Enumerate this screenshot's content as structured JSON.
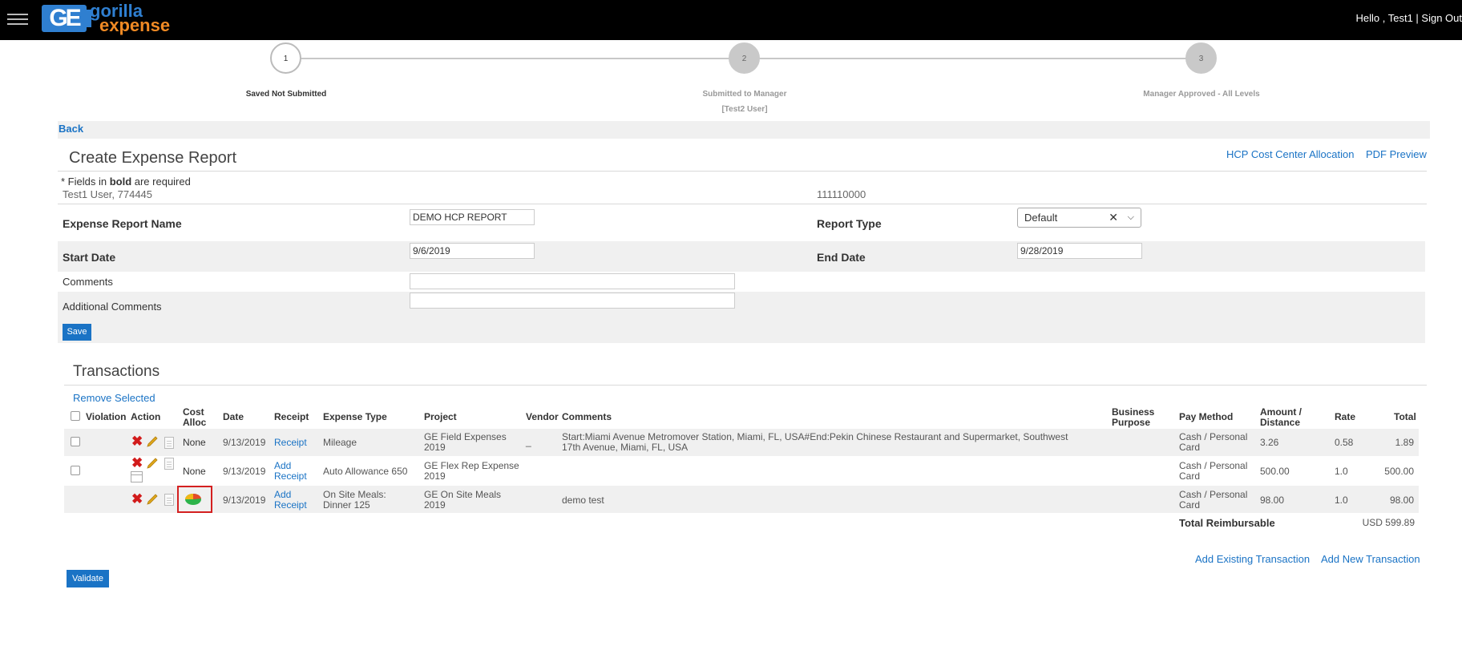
{
  "header": {
    "logo_text_1": "gorilla",
    "logo_text_2": "expense",
    "logo_mark": "GE",
    "greeting": "Hello , Test1 | Sign Out"
  },
  "progress": {
    "steps": [
      {
        "number": "1",
        "label": "Saved Not Submitted",
        "sub": ""
      },
      {
        "number": "2",
        "label": "Submitted to Manager",
        "sub": "[Test2 User]"
      },
      {
        "number": "3",
        "label": "Manager Approved - All Levels",
        "sub": ""
      }
    ]
  },
  "nav": {
    "back": "Back"
  },
  "report": {
    "title": "Create Expense Report",
    "links": {
      "hcp": "HCP Cost Center Allocation",
      "pdf": "PDF Preview"
    },
    "note_prefix": "* Fields in ",
    "note_bold": "bold",
    "note_suffix": " are required",
    "user_line": "Test1 User, 774445",
    "account": "111110000",
    "fields": {
      "name_label": "Expense Report Name",
      "name_value": "DEMO HCP REPORT",
      "type_label": "Report Type",
      "type_value": "Default",
      "start_label": "Start Date",
      "start_value": "9/6/2019",
      "end_label": "End Date",
      "end_value": "9/28/2019",
      "comments_label": "Comments",
      "comments_value": "",
      "additional_label": "Additional Comments",
      "additional_value": ""
    },
    "save": "Save"
  },
  "transactions": {
    "title": "Transactions",
    "remove_selected": "Remove Selected",
    "columns": {
      "violation": "Violation",
      "action": "Action",
      "cost_alloc_1": "Cost",
      "cost_alloc_2": "Alloc",
      "date": "Date",
      "receipt": "Receipt",
      "expense_type": "Expense Type",
      "project": "Project",
      "vendor": "Vendor",
      "comments": "Comments",
      "business_purpose_1": "Business",
      "business_purpose_2": "Purpose",
      "pay_method": "Pay Method",
      "amount_1": "Amount /",
      "amount_2": "Distance",
      "rate": "Rate",
      "total": "Total"
    },
    "rows": [
      {
        "cost_alloc": "None",
        "date": "9/13/2019",
        "receipt_1": "Receipt",
        "receipt_2": "",
        "expense_type_1": "Mileage",
        "expense_type_2": "",
        "project_1": "GE Field Expenses",
        "project_2": "2019",
        "vendor": "_",
        "comments_1": "Start:Miami Avenue Metromover Station, Miami, FL, USA#End:Pekin Chinese Restaurant and Supermarket, Southwest",
        "comments_2": "17th Avenue, Miami, FL, USA",
        "pay_method_1": "Cash / Personal",
        "pay_method_2": "Card",
        "amount": "3.26",
        "rate": "0.58",
        "total": "1.89"
      },
      {
        "cost_alloc": "None",
        "date": "9/13/2019",
        "receipt_1": "Add",
        "receipt_2": "Receipt",
        "expense_type_1": "Auto Allowance 650",
        "expense_type_2": "",
        "project_1": "GE Flex Rep Expense",
        "project_2": "2019",
        "vendor": "",
        "comments_1": "",
        "comments_2": "",
        "pay_method_1": "Cash / Personal",
        "pay_method_2": "Card",
        "amount": "500.00",
        "rate": "1.0",
        "total": "500.00"
      },
      {
        "cost_alloc": "",
        "date": "9/13/2019",
        "receipt_1": "Add",
        "receipt_2": "Receipt",
        "expense_type_1": "On Site Meals:",
        "expense_type_2": "Dinner 125",
        "project_1": "GE On Site Meals",
        "project_2": "2019",
        "vendor": "",
        "comments_1": "demo test",
        "comments_2": "",
        "pay_method_1": "Cash / Personal",
        "pay_method_2": "Card",
        "amount": "98.00",
        "rate": "1.0",
        "total": "98.00"
      }
    ],
    "total_label": "Total Reimbursable",
    "total_value": "USD 599.89",
    "add_existing": "Add Existing Transaction",
    "add_new": "Add New Transaction",
    "validate": "Validate"
  },
  "colors": {
    "accent": "#1a73c5",
    "topbar": "#000000",
    "logo_blue": "#2f7fd0",
    "logo_orange": "#f08a24",
    "delete_red": "#d21b1b",
    "highlight_red": "#d42020"
  }
}
